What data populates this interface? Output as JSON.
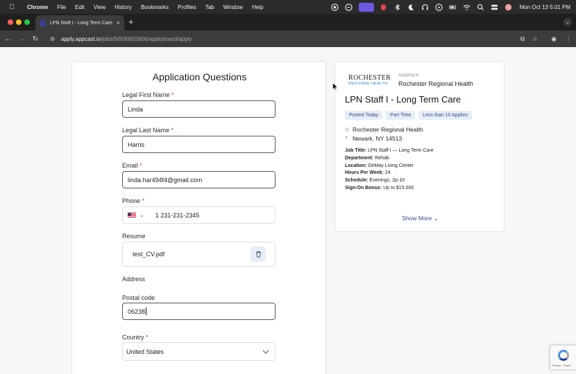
{
  "menubar": {
    "app": "Chrome",
    "items": [
      "File",
      "Edit",
      "View",
      "History",
      "Bookmarks",
      "Profiles",
      "Tab",
      "Window",
      "Help"
    ],
    "clock": "Mon Oct 13  5:01 PM",
    "status_icons": [
      "record-icon",
      "vpn-icon",
      "screen-share-icon",
      "shield-icon",
      "bluetooth-icon",
      "moon-icon",
      "headphones-icon",
      "play-icon",
      "battery-icon",
      "wifi-icon",
      "search-icon",
      "control-center-icon",
      "avatar-icon"
    ]
  },
  "browser": {
    "tab_title": "LPN Staff I - Long Term Care",
    "url_host": "apply.appcast.io",
    "url_path": "/jobs/50590620606/applyboard/apply"
  },
  "form": {
    "title": "Application Questions",
    "first_name_label": "Legal First Name",
    "first_name_value": "Linda",
    "last_name_label": "Legal Last Name",
    "last_name_value": "Harris",
    "email_label": "Email",
    "email_value": "linda.har494f4@gmail.com",
    "phone_label": "Phone",
    "phone_value": "1 231-231-2345",
    "resume_label": "Resume",
    "resume_file": "test_CV.pdf",
    "address_label": "Address",
    "postal_label": "Postal code",
    "postal_value": "06238",
    "country_label": "Country",
    "country_value": "United States",
    "required_mark": "*"
  },
  "job": {
    "logo_line1": "ROCHESTER",
    "logo_line2": "REGIONAL HEALTH",
    "applying_to": "Applying to",
    "employer": "Rochester Regional Health",
    "title": "LPN Staff I - Long Term Care",
    "tags": [
      "Posted Today",
      "Part Time",
      "Less than 10 Applies"
    ],
    "company": "Rochester Regional Health",
    "location": "Newark, NY 14513",
    "details": [
      {
        "label": "Job Title:",
        "value": "LPN Staff I — Long Term Care"
      },
      {
        "label": "Department:",
        "value": "Rehab"
      },
      {
        "label": "Location:",
        "value": "DeMay Living Center"
      },
      {
        "label": "Hours Per Week:",
        "value": "24"
      },
      {
        "label": "Schedule:",
        "value": "Evenings, 2p-10"
      },
      {
        "label": "Sign-On Bonus:",
        "value": "Up to $15,000"
      }
    ],
    "show_more": "Show More"
  },
  "recaptcha": {
    "text": "Privacy - Terms"
  },
  "colors": {
    "accent": "#2d4e86",
    "tag_bg": "#e6edf8",
    "required": "#c0392b"
  }
}
